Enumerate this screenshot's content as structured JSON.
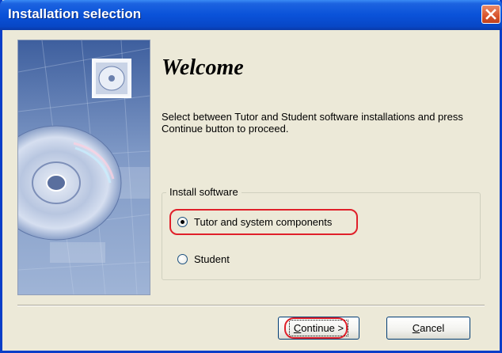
{
  "window": {
    "title": "Installation selection"
  },
  "heading": "Welcome",
  "description": "Select between Tutor and Student software installations and press Continue button to proceed.",
  "install_group": {
    "legend": "Install software",
    "options": [
      {
        "label": "Tutor and system components",
        "checked": true
      },
      {
        "label": "Student",
        "checked": false
      }
    ]
  },
  "buttons": {
    "continue": {
      "accel": "C",
      "rest": "ontinue >"
    },
    "cancel": {
      "accel": "C",
      "rest": "ancel"
    }
  },
  "colors": {
    "titlebar": "#0a52d9",
    "annotation_highlight": "#e0202a",
    "dialog_bg": "#ece9d8"
  },
  "icons": {
    "close": "close-icon",
    "cd_disc": "cd-disc-icon"
  }
}
